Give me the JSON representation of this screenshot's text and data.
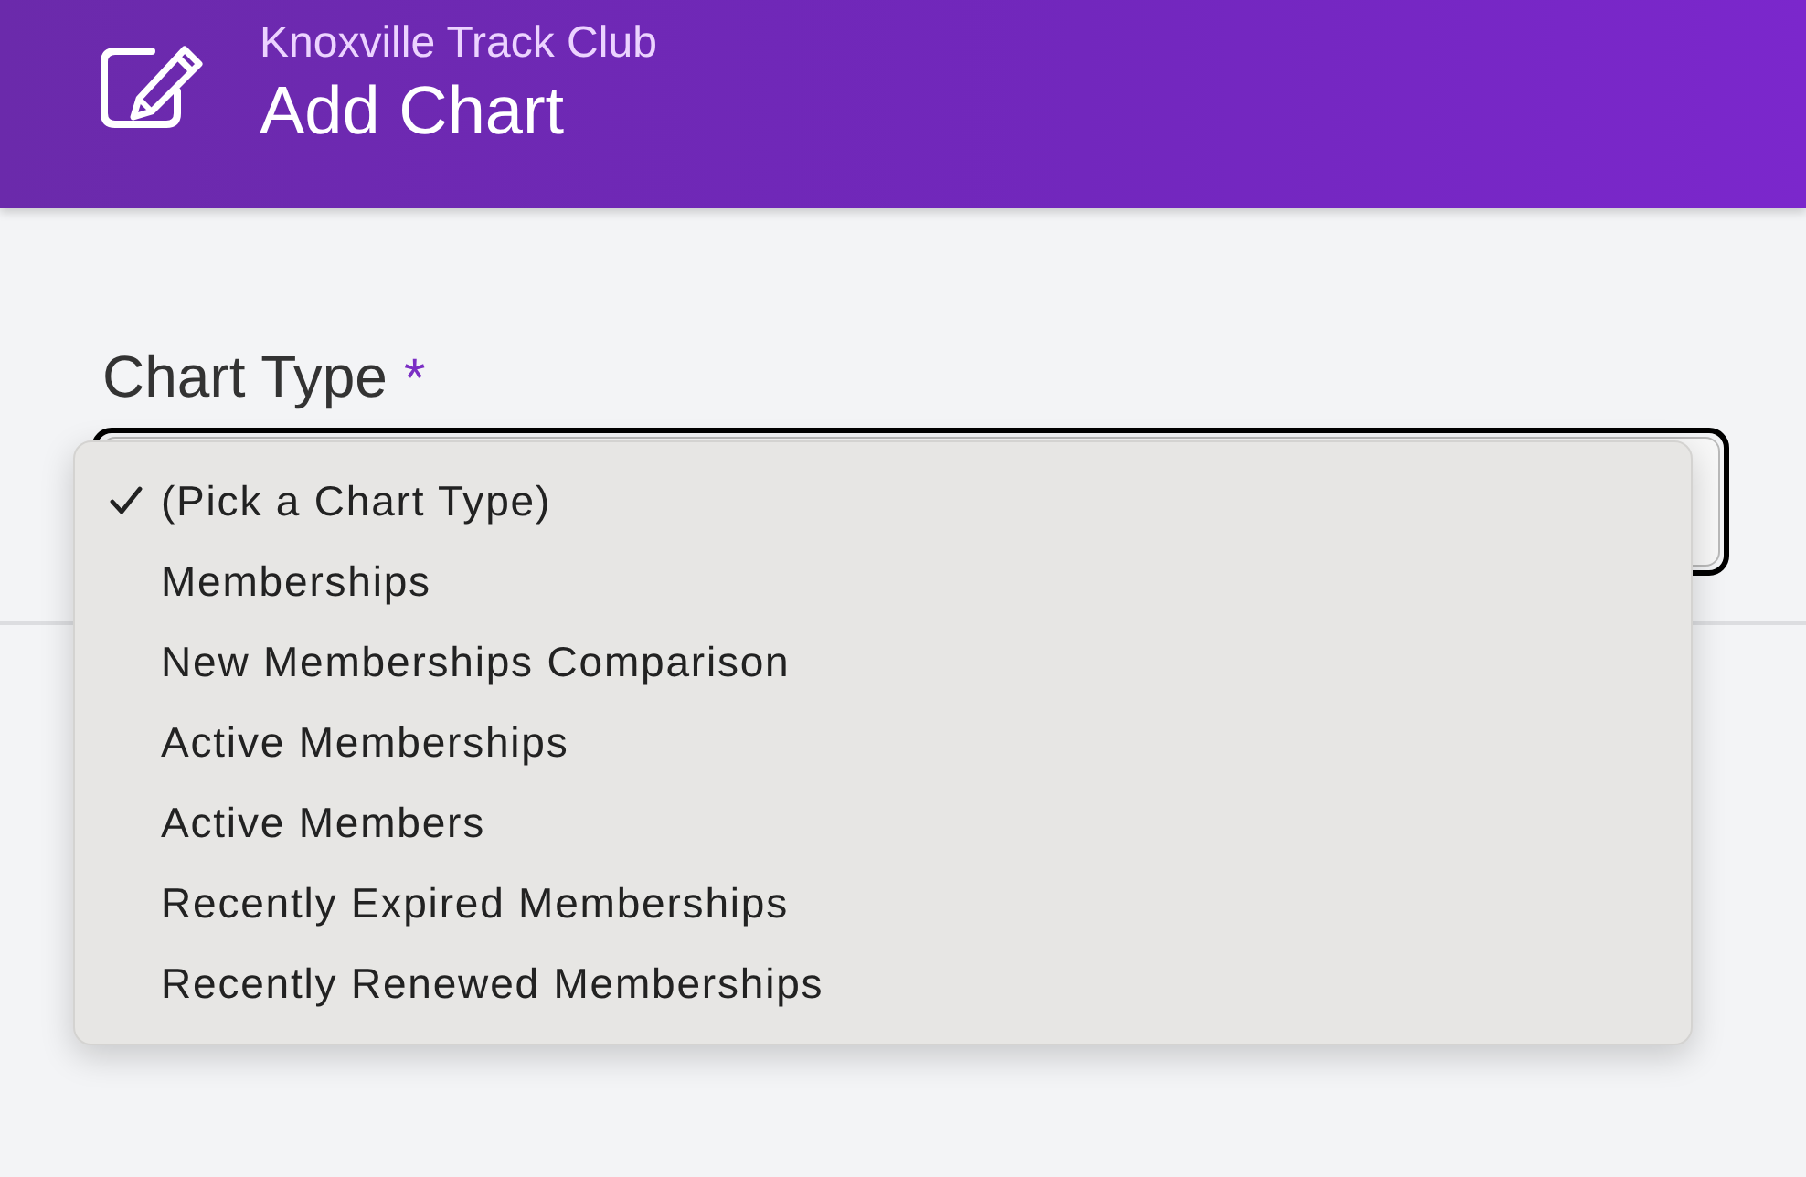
{
  "header": {
    "organization": "Knoxville Track Club",
    "title": "Add Chart"
  },
  "form": {
    "field": {
      "label": "Chart Type",
      "required_mark": "*"
    },
    "dropdown": {
      "options": [
        {
          "label": "(Pick a Chart Type)",
          "selected": true
        },
        {
          "label": "Memberships",
          "selected": false
        },
        {
          "label": "New Memberships Comparison",
          "selected": false
        },
        {
          "label": "Active Memberships",
          "selected": false
        },
        {
          "label": "Active Members",
          "selected": false
        },
        {
          "label": "Recently Expired Memberships",
          "selected": false
        },
        {
          "label": "Recently Renewed Memberships",
          "selected": false
        }
      ]
    }
  }
}
